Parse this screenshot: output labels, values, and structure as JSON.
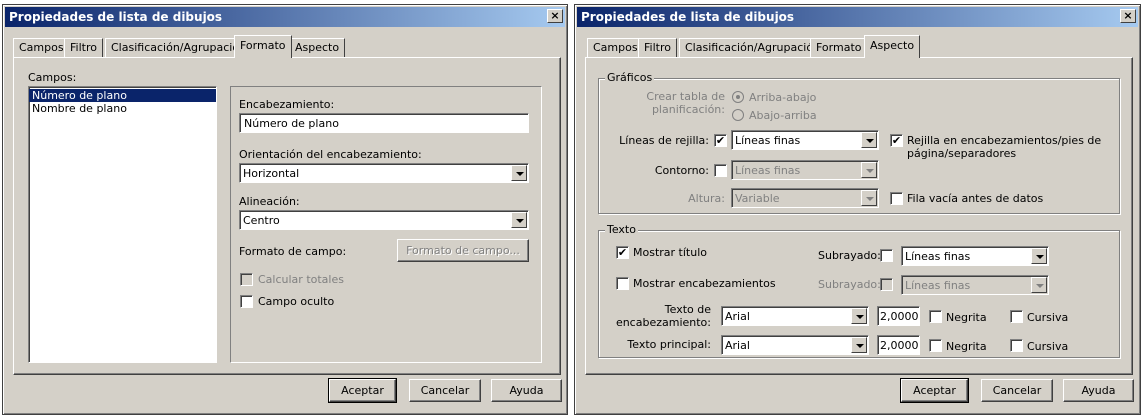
{
  "left": {
    "title": "Propiedades de lista de dibujos",
    "close": "×",
    "tabs": [
      "Campos",
      "Filtro",
      "Clasificación/Agrupación",
      "Formato",
      "Aspecto"
    ],
    "campos_label": "Campos:",
    "campos_items": [
      "Número de plano",
      "Nombre de plano"
    ],
    "encabezamiento_label": "Encabezamiento:",
    "encabezamiento_value": "Número de plano",
    "orientacion_label": "Orientación del encabezamiento:",
    "orientacion_value": "Horizontal",
    "alineacion_label": "Alineación:",
    "alineacion_value": "Centro",
    "formato_campo_label": "Formato de campo:",
    "formato_campo_button": "Formato de campo...",
    "calcular_totales": "Calcular totales",
    "campo_oculto": "Campo oculto",
    "aceptar": "Aceptar",
    "cancelar": "Cancelar",
    "ayuda": "Ayuda"
  },
  "right": {
    "title": "Propiedades de lista de dibujos",
    "close": "×",
    "tabs": [
      "Campos",
      "Filtro",
      "Clasificación/Agrupación",
      "Formato",
      "Aspecto"
    ],
    "graficos": {
      "caption": "Gráficos",
      "crear_tabla_line1": "Crear tabla de",
      "crear_tabla_line2": "planificación:",
      "arriba_abajo": "Arriba-abajo",
      "abajo_arriba": "Abajo-arriba",
      "lineas_rejilla_label": "Líneas de rejilla:",
      "lineas_rejilla_value": "Líneas finas",
      "rejilla_enc_line1": "Rejilla en encabezamientos/pies de",
      "rejilla_enc_line2": "página/separadores",
      "contorno_label": "Contorno:",
      "contorno_value": "Líneas finas",
      "altura_label": "Altura:",
      "altura_value": "Variable",
      "fila_vacia": "Fila vacía antes de datos"
    },
    "texto": {
      "caption": "Texto",
      "mostrar_titulo": "Mostrar título",
      "subrayado1_label": "Subrayado:",
      "subrayado1_value": "Líneas finas",
      "mostrar_encabezamientos": "Mostrar encabezamientos",
      "subrayado2_label": "Subrayado:",
      "subrayado2_value": "Líneas finas",
      "texto_enc_line1": "Texto de",
      "texto_enc_line2": "encabezamiento:",
      "texto_enc_font": "Arial",
      "texto_enc_size": "2,0000",
      "negrita1": "Negrita",
      "cursiva1": "Cursiva",
      "texto_principal_label": "Texto principal:",
      "texto_principal_font": "Arial",
      "texto_principal_size": "2,0000",
      "negrita2": "Negrita",
      "cursiva2": "Cursiva"
    },
    "aceptar": "Aceptar",
    "cancelar": "Cancelar",
    "ayuda": "Ayuda"
  },
  "check_mark": "✔"
}
